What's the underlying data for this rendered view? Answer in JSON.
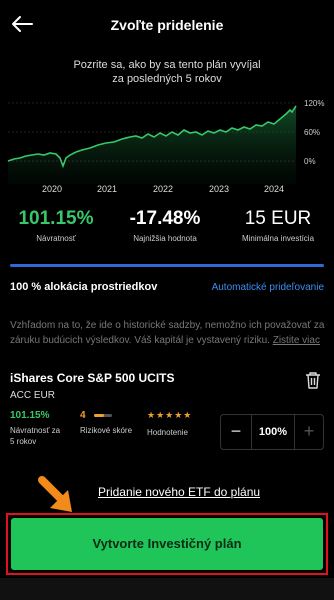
{
  "header": {
    "title": "Zvoľte pridelenie",
    "back_icon": "arrow-left-icon"
  },
  "chart": {
    "subtitle_line1": "Pozrite sa, ako by sa tento plán vyvíjal",
    "subtitle_line2": "za posledných 5 rokov",
    "y_ticks": [
      "120%",
      "60%",
      "0%"
    ],
    "x_ticks": [
      "2020",
      "2021",
      "2022",
      "2023",
      "2024"
    ],
    "line_color": "#37c86a"
  },
  "stats": {
    "return_value": "101.15%",
    "return_label": "Návratnosť",
    "lowest_value": "-17.48%",
    "lowest_label": "Najnižšia hodnota",
    "min_value": "15 EUR",
    "min_label": "Minimálna investícia"
  },
  "allocation": {
    "title": "100 % alokácia prostriedkov",
    "auto_link": "Automatické prideľovanie"
  },
  "disclaimer": {
    "text": "Vzhľadom na to, že ide o historické sadzby, nemožno ich považovať za záruku budúcich výsledkov. Váš kapitál je vystavený riziku. ",
    "link": "Zistite viac"
  },
  "fund": {
    "name": "iShares Core S&P 500 UCITS",
    "sub": "ACC EUR",
    "return_value": "101.15%",
    "return_label_1": "Návratnosť za",
    "return_label_2": "5 rokov",
    "risk_value": "4",
    "risk_level": 0.57,
    "risk_label": "Rizikové skóre",
    "rating_stars": "★★★★★",
    "rating_label": "Hodnotenie",
    "allocation_value": "100%",
    "minus": "−",
    "plus": "+"
  },
  "add_etf": "Pridanie nového ETF do plánu",
  "cta": "Vytvorte Investičný plán",
  "colors": {
    "accent_green": "#20c55a",
    "link_blue": "#3b8ef0",
    "highlight_red": "#e0121f",
    "annotation_orange": "#f28a1c"
  }
}
